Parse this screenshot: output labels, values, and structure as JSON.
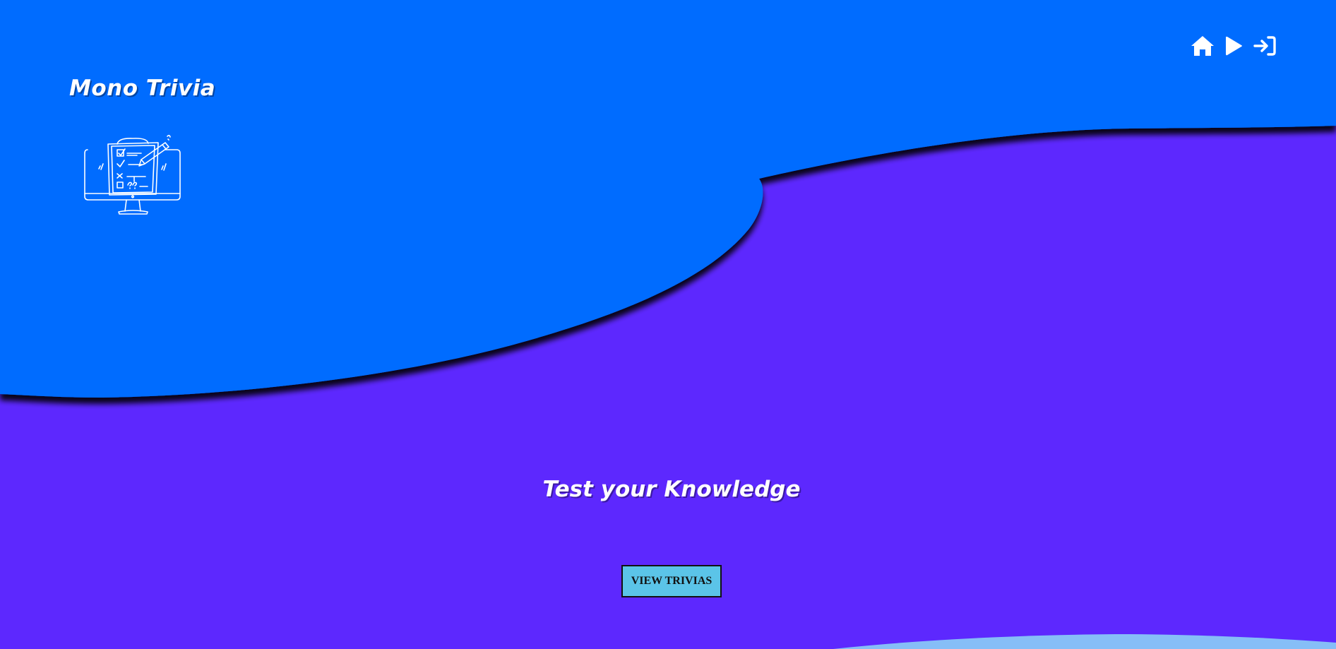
{
  "app": {
    "title": "Mono Trivia"
  },
  "nav": {
    "items": [
      {
        "icon": "home-icon",
        "label": "Home"
      },
      {
        "icon": "play-icon",
        "label": "Play"
      },
      {
        "icon": "sign-in-icon",
        "label": "Sign in"
      }
    ]
  },
  "hero": {
    "heading": "Test your Knowledge",
    "cta_label": "VIEW TRIVIAS"
  },
  "colors": {
    "top_wave": "#006cff",
    "background": "#5d28fe",
    "bottom_wave": "#86bef7",
    "cta_background": "#5bc4e8",
    "text": "#ffffff"
  }
}
